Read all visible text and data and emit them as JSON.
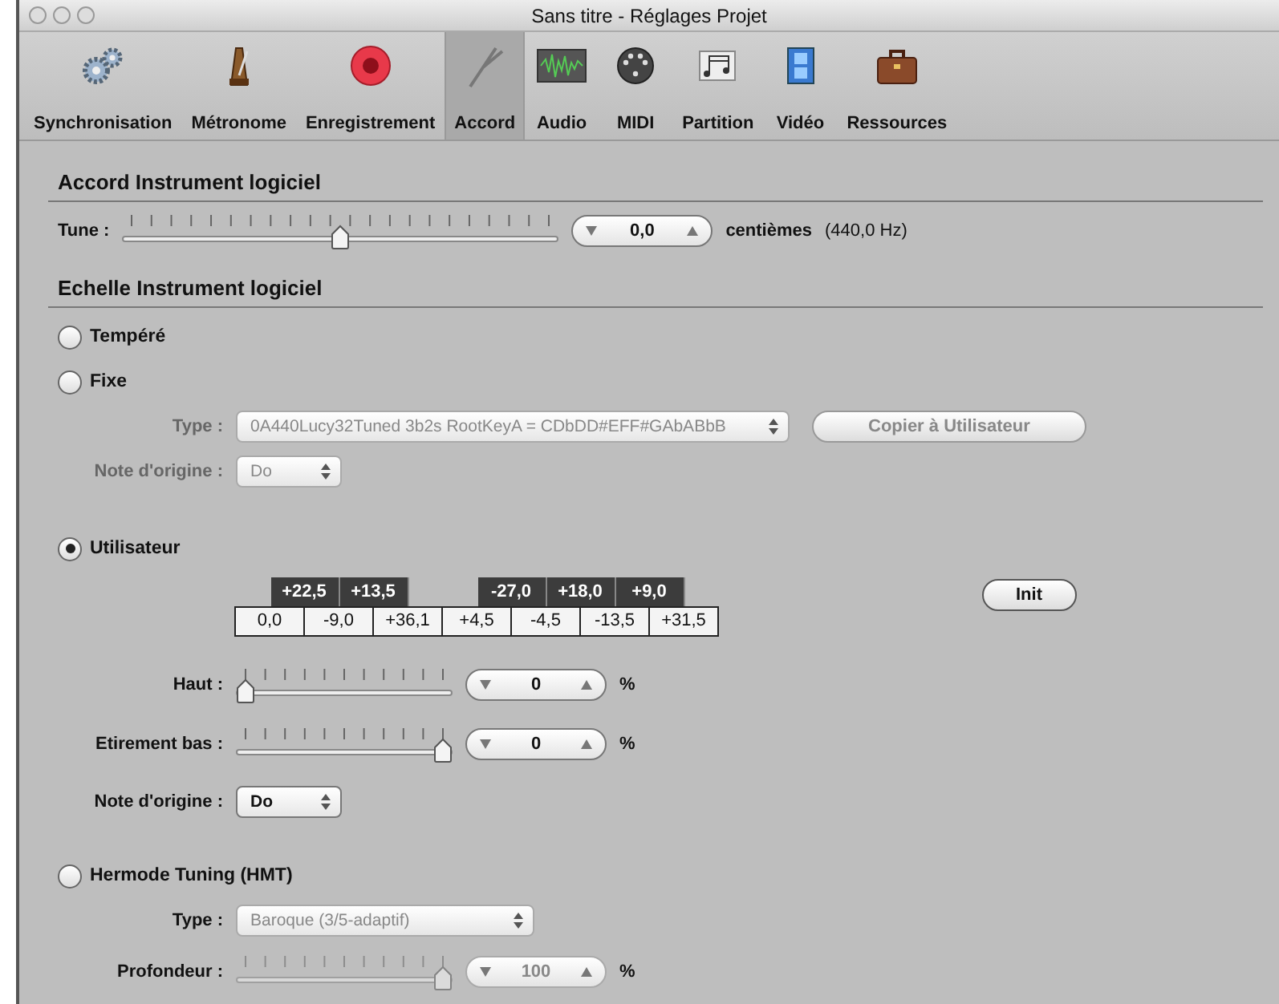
{
  "window": {
    "title": "Sans titre - Réglages Projet"
  },
  "toolbar": [
    {
      "kind": "gears",
      "label": "Synchronisation",
      "selected": false
    },
    {
      "kind": "metronome",
      "label": "Métronome",
      "selected": false
    },
    {
      "kind": "record",
      "label": "Enregistrement",
      "selected": false
    },
    {
      "kind": "fork",
      "label": "Accord",
      "selected": true
    },
    {
      "kind": "audio",
      "label": "Audio",
      "selected": false
    },
    {
      "kind": "midi",
      "label": "MIDI",
      "selected": false
    },
    {
      "kind": "score",
      "label": "Partition",
      "selected": false
    },
    {
      "kind": "video",
      "label": "Vidéo",
      "selected": false
    },
    {
      "kind": "case",
      "label": "Ressources",
      "selected": false
    }
  ],
  "tuning": {
    "heading": "Accord Instrument logiciel",
    "label": "Tune :",
    "level": 0.5,
    "value": "0,0",
    "unit": "centièmes",
    "hz": "(440,0 Hz)"
  },
  "scale": {
    "heading": "Echelle Instrument logiciel",
    "options": [
      {
        "kind": "plain",
        "label": "Tempéré",
        "selected": false
      },
      {
        "kind": "fixed",
        "label": "Fixe",
        "selected": false,
        "type_label": "Type :",
        "type_value": "0A440Lucy32Tuned 3b2s RootKeyA = CDbDD#EFF#GAbABbB",
        "copy_button": "Copier à Utilisateur",
        "root_label": "Note d'origine :",
        "root_value": "Do"
      },
      {
        "kind": "user",
        "label": "Utilisateur",
        "selected": true,
        "black_keys": [
          "+22,5",
          "+13,5",
          "-27,0",
          "+18,0",
          "+9,0"
        ],
        "white_keys": [
          "0,0",
          "-9,0",
          "+36,1",
          "+4,5",
          "-4,5",
          "-13,5",
          "+31,5"
        ],
        "init_button": "Init",
        "sliders": [
          {
            "label": "Haut :",
            "level": 0,
            "value": "0",
            "unit": "%"
          },
          {
            "label": "Etirement bas :",
            "level": 1,
            "value": "0",
            "unit": "%"
          }
        ],
        "root_label": "Note d'origine :",
        "root_value": "Do"
      },
      {
        "kind": "hmt",
        "label": "Hermode Tuning (HMT)",
        "selected": false,
        "type_label": "Type :",
        "type_value": "Baroque (3/5-adaptif)",
        "sliders": [
          {
            "label": "Profondeur :",
            "level": 1,
            "value": "100",
            "unit": "%"
          }
        ]
      }
    ]
  }
}
